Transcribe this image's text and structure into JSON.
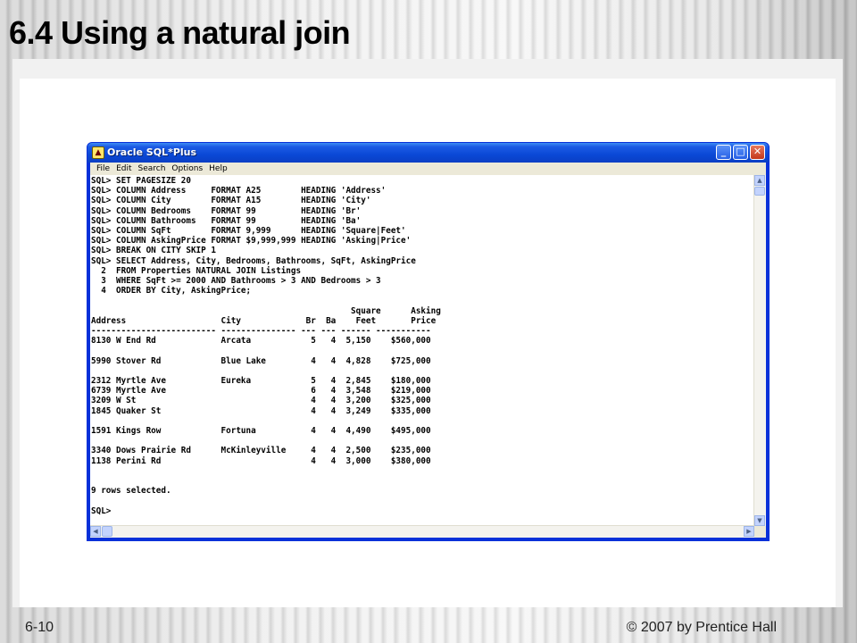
{
  "slide": {
    "title": "6.4 Using a natural join",
    "footer_left": "6-10",
    "footer_right": "© 2007 by Prentice Hall"
  },
  "window": {
    "title": "Oracle SQL*Plus",
    "icon": "sqlplus-app-icon",
    "controls": {
      "minimize": "_",
      "maximize": "□",
      "close": "✕"
    },
    "menu": [
      "File",
      "Edit",
      "Search",
      "Options",
      "Help"
    ]
  },
  "console_lines": [
    "SQL> SET PAGESIZE 20",
    "SQL> COLUMN Address     FORMAT A25        HEADING 'Address'",
    "SQL> COLUMN City        FORMAT A15        HEADING 'City'",
    "SQL> COLUMN Bedrooms    FORMAT 99         HEADING 'Br'",
    "SQL> COLUMN Bathrooms   FORMAT 99         HEADING 'Ba'",
    "SQL> COLUMN SqFt        FORMAT 9,999      HEADING 'Square|Feet'",
    "SQL> COLUMN AskingPrice FORMAT $9,999,999 HEADING 'Asking|Price'",
    "SQL> BREAK ON CITY SKIP 1",
    "SQL> SELECT Address, City, Bedrooms, Bathrooms, SqFt, AskingPrice",
    "  2  FROM Properties NATURAL JOIN Listings",
    "  3  WHERE SqFt >= 2000 AND Bathrooms > 3 AND Bedrooms > 3",
    "  4  ORDER BY City, AskingPrice;",
    "",
    "                                                    Square      Asking",
    "Address                   City             Br  Ba    Feet       Price",
    "------------------------- --------------- --- --- ------ -----------",
    "8130 W End Rd             Arcata            5   4  5,150    $560,000",
    "",
    "5990 Stover Rd            Blue Lake         4   4  4,828    $725,000",
    "",
    "2312 Myrtle Ave           Eureka            5   4  2,845    $180,000",
    "6739 Myrtle Ave                             6   4  3,548    $219,000",
    "3209 W St                                   4   4  3,200    $325,000",
    "1845 Quaker St                              4   4  3,249    $335,000",
    "",
    "1591 Kings Row            Fortuna           4   4  4,490    $495,000",
    "",
    "3340 Dows Prairie Rd      McKinleyville     4   4  2,500    $235,000",
    "1138 Perini Rd                              4   4  3,000    $380,000",
    "",
    "",
    "9 rows selected.",
    "",
    "SQL>"
  ],
  "colors": {
    "titlebar": "#0a48d6",
    "menubar": "#ece9d8",
    "console_bg": "#ffffff"
  }
}
